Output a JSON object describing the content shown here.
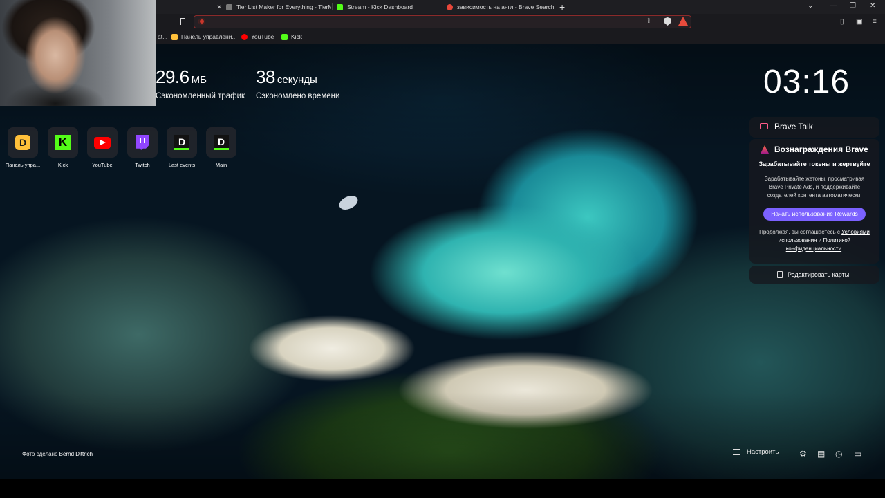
{
  "tabs": [
    {
      "title": "Tier List Maker for Everything - TierMa",
      "fav_color": "#7a7a7a"
    },
    {
      "title": "Stream - Kick Dashboard",
      "fav_color": "#53fc18"
    },
    {
      "title": "зависимость на англ - Brave Search",
      "fav_color": "#e8473a"
    }
  ],
  "tab_close": "✕",
  "new_tab": "+",
  "window_controls": {
    "dropdown": "⌄",
    "minimize": "—",
    "restore": "❐",
    "close": "✕"
  },
  "address_bar": {
    "value": "",
    "placeholder": ""
  },
  "bookmarks": [
    {
      "label": "Панель управлени...",
      "icon": "dlive-icon",
      "color": "#ffc03a"
    },
    {
      "label": "YouTube",
      "icon": "youtube-icon",
      "color": "#ff0000"
    },
    {
      "label": "Kick",
      "icon": "kick-icon",
      "color": "#53fc18"
    }
  ],
  "bookmarks_overflow": "at...",
  "stats": {
    "data_saved": {
      "value": "29.6",
      "unit": "МБ",
      "label": "Сэкономленный трафик"
    },
    "time_saved": {
      "value": "38",
      "unit": "секунды",
      "label": "Сэкономлено времени"
    }
  },
  "clock": "03:16",
  "top_sites": [
    {
      "name": "Панель упра...",
      "icon": "dlive-icon",
      "glyph": "D"
    },
    {
      "name": "Kick",
      "icon": "kick-icon",
      "glyph": "K"
    },
    {
      "name": "YouTube",
      "icon": "youtube-icon",
      "glyph": ""
    },
    {
      "name": "Twitch",
      "icon": "twitch-icon",
      "glyph": ""
    },
    {
      "name": "Last events",
      "icon": "donationalerts-icon",
      "glyph": "D"
    },
    {
      "name": "Main",
      "icon": "donationalerts-icon",
      "glyph": "D"
    }
  ],
  "brave_talk": {
    "title": "Brave Talk"
  },
  "rewards": {
    "title": "Вознаграждения Brave",
    "subtitle": "Зарабатывайте токены и жертвуйте",
    "description": "Зарабатывайте жетоны, просматривая Brave Private Ads, и поддерживайте создателей контента автоматически.",
    "button": "Начать использование Rewards",
    "terms_prefix": "Продолжая, вы соглашаетесь с",
    "terms_link": "Условиями использования",
    "terms_and": "и",
    "privacy_link": "Политикой конфиденциальности",
    "terms_suffix": "."
  },
  "edit_cards": "Редактировать карты",
  "photo_credit": {
    "prefix": "Фото сделано",
    "author": "Bernd Dittrich"
  },
  "customize": "Настроить"
}
